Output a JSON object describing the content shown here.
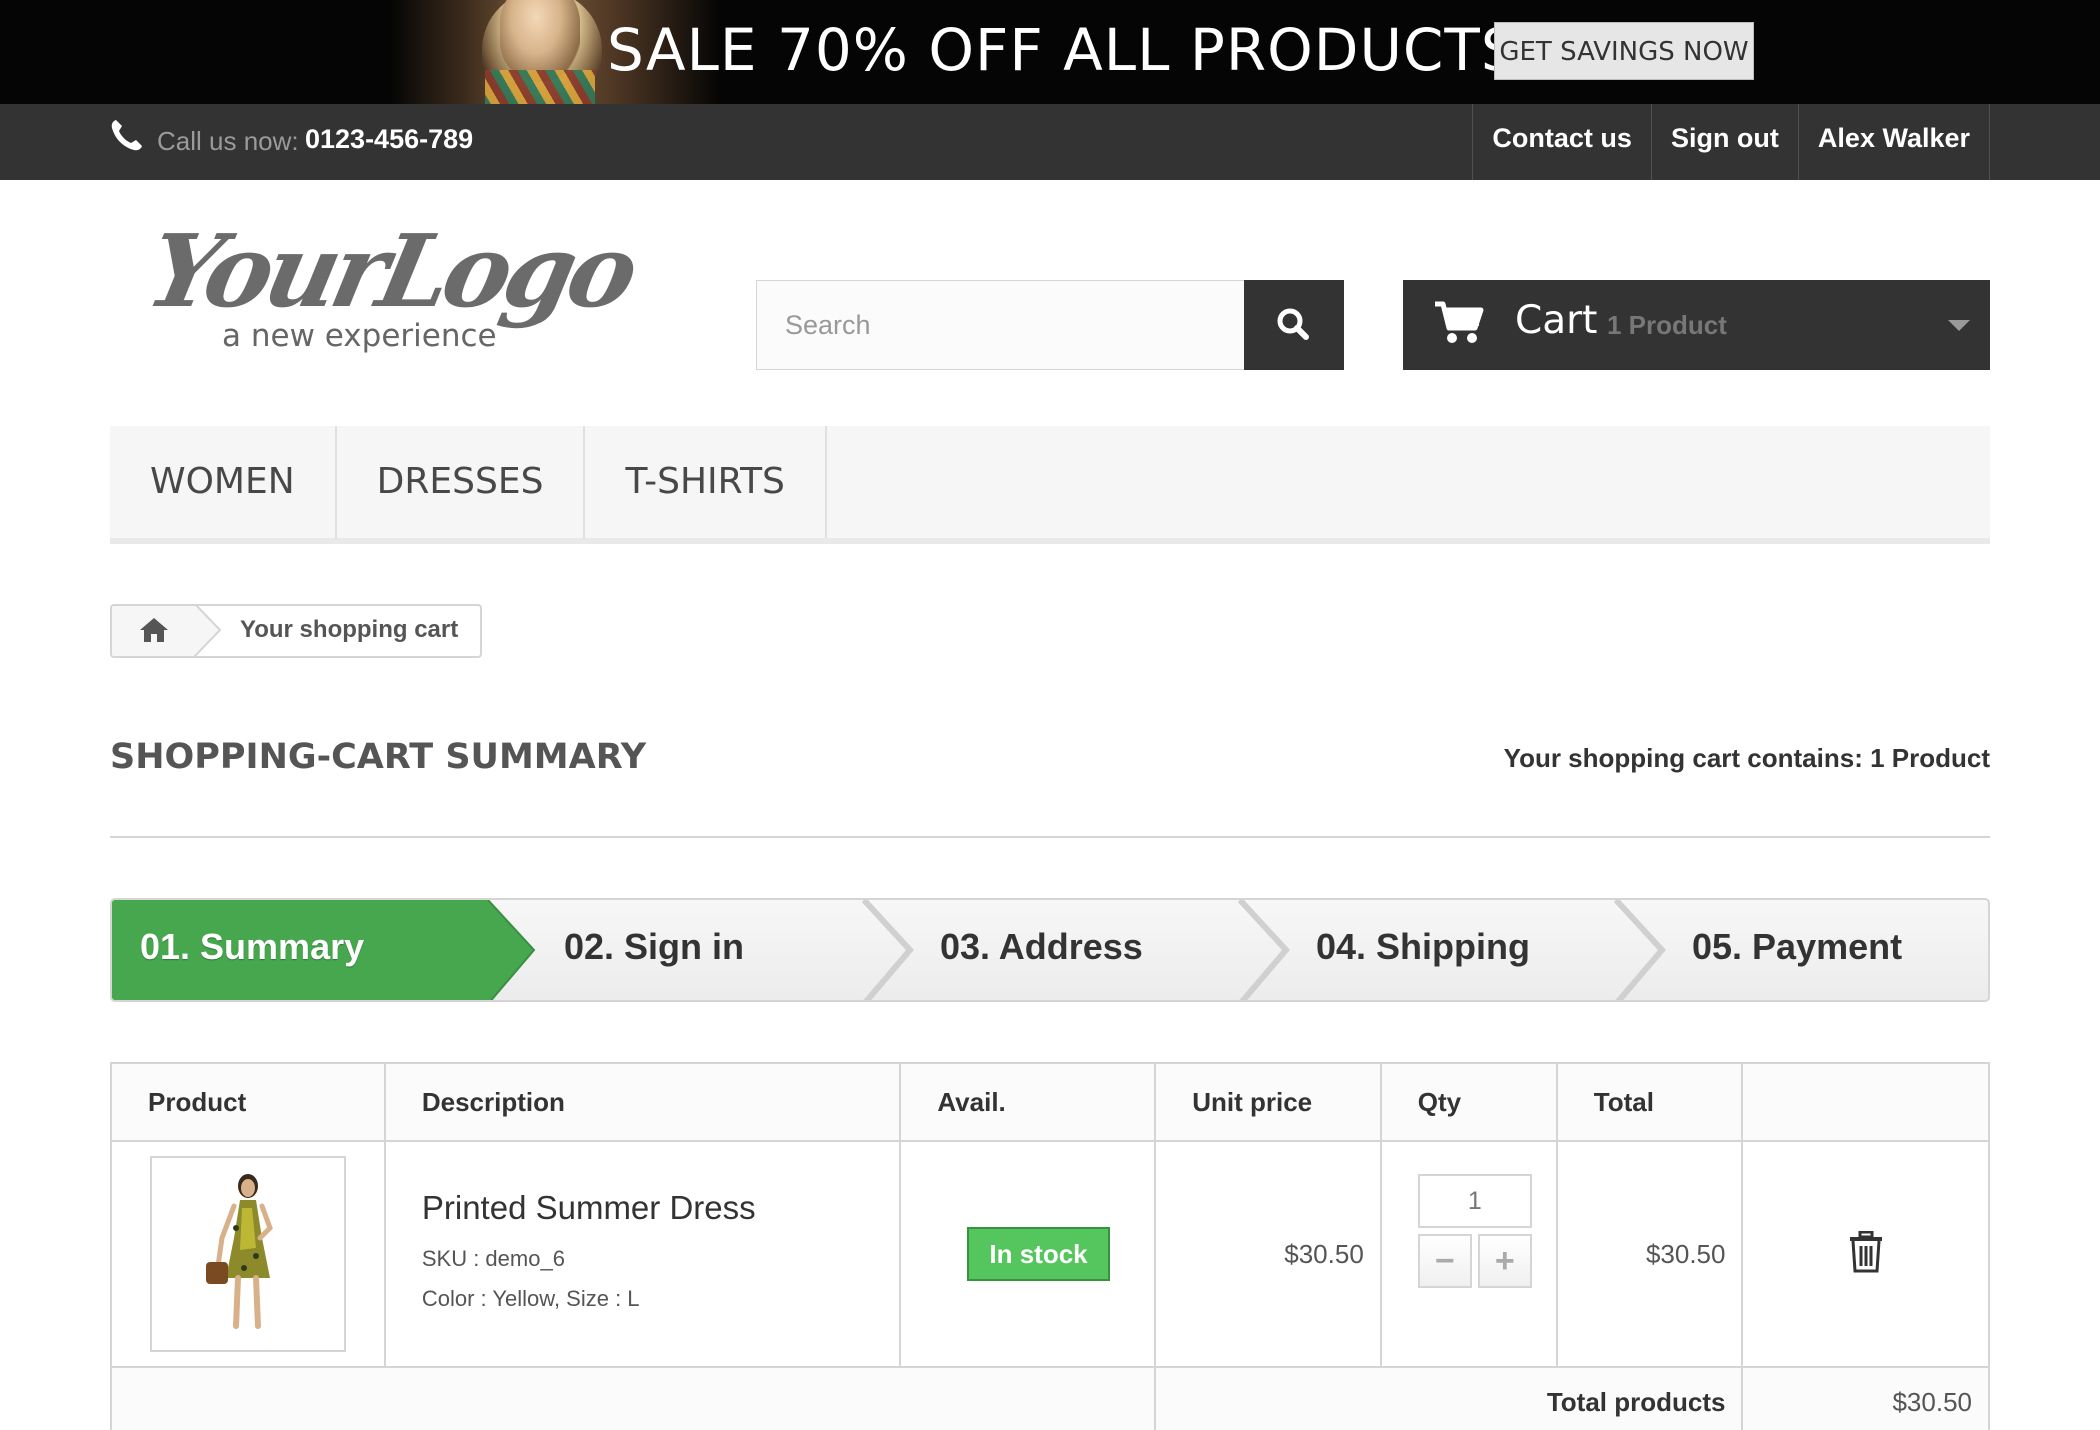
{
  "banner": {
    "title": "SALE 70% OFF ALL PRODUCTS",
    "button_label": "GET SAVINGS NOW"
  },
  "topbar": {
    "call_label": "Call us now:",
    "call_number": "0123-456-789",
    "links": [
      {
        "label": "Contact us"
      },
      {
        "label": "Sign out"
      },
      {
        "label": "Alex Walker"
      }
    ]
  },
  "header": {
    "logo_text": "YourLogo",
    "logo_tagline": "a new experience",
    "search_placeholder": "Search",
    "cart_label": "Cart",
    "cart_count": "1 Product"
  },
  "menu": {
    "items": [
      {
        "label": "WOMEN"
      },
      {
        "label": "DRESSES"
      },
      {
        "label": "T-SHIRTS"
      }
    ]
  },
  "breadcrumb": {
    "current": "Your shopping cart"
  },
  "page": {
    "heading": "SHOPPING-CART SUMMARY",
    "cart_contains": "Your shopping cart contains: 1 Product"
  },
  "steps": [
    {
      "label": "01. Summary",
      "active": true
    },
    {
      "label": "02. Sign in",
      "active": false
    },
    {
      "label": "03. Address",
      "active": false
    },
    {
      "label": "04. Shipping",
      "active": false
    },
    {
      "label": "05. Payment",
      "active": false
    }
  ],
  "table": {
    "headers": [
      "Product",
      "Description",
      "Avail.",
      "Unit price",
      "Qty",
      "Total",
      ""
    ],
    "rows": [
      {
        "name": "Printed Summer Dress",
        "sku": "SKU : demo_6",
        "attributes": "Color : Yellow, Size : L",
        "availability": "In stock",
        "unit_price": "$30.50",
        "qty": "1",
        "total": "$30.50"
      }
    ],
    "total_products_label": "Total products",
    "total_products_value": "$30.50"
  },
  "colors": {
    "dark": "#333333",
    "active_step": "#46a74e",
    "in_stock": "#55c65e"
  },
  "icons": [
    "phone-icon",
    "search-icon",
    "cart-icon",
    "caret-down-icon",
    "home-icon",
    "minus-icon",
    "plus-icon",
    "trash-icon"
  ]
}
